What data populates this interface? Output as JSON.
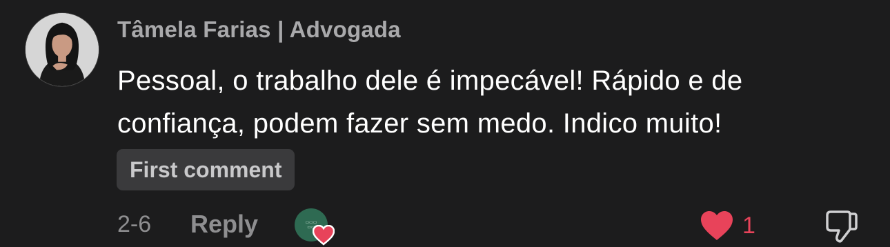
{
  "comment": {
    "author": "Tâmela Farias | Advogada",
    "text": "Pessoal, o trabalho dele é impecável! Rápido e de confiança, podem fazer sem medo. Indico muito!",
    "badge": "First comment",
    "date": "2-6",
    "reply_label": "Reply",
    "like_count": "1",
    "liked": true
  },
  "colors": {
    "background": "#1c1c1d",
    "author": "#a9a9ab",
    "text": "#ffffff",
    "badge_bg": "#3a3a3c",
    "muted": "#8e8e90",
    "like": "#e8435a"
  },
  "icons": {
    "avatar": "author-avatar",
    "liker": "creator-liked-avatar",
    "like": "heart-icon",
    "dislike": "thumbs-down-icon"
  }
}
